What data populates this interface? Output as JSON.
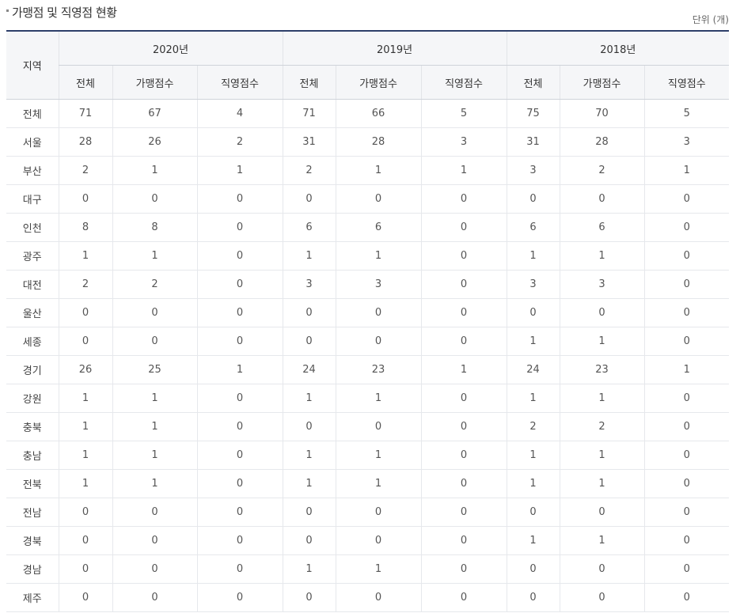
{
  "header": {
    "title": "가맹점 및 직영점 현황",
    "unit": "단위 (개)"
  },
  "table": {
    "region_header": "지역",
    "years": [
      "2020년",
      "2019년",
      "2018년"
    ],
    "sub_headers": [
      "전체",
      "가맹점수",
      "직영점수"
    ],
    "rows": [
      {
        "region": "전체",
        "values": [
          "71",
          "67",
          "4",
          "71",
          "66",
          "5",
          "75",
          "70",
          "5"
        ]
      },
      {
        "region": "서울",
        "values": [
          "28",
          "26",
          "2",
          "31",
          "28",
          "3",
          "31",
          "28",
          "3"
        ]
      },
      {
        "region": "부산",
        "values": [
          "2",
          "1",
          "1",
          "2",
          "1",
          "1",
          "3",
          "2",
          "1"
        ]
      },
      {
        "region": "대구",
        "values": [
          "0",
          "0",
          "0",
          "0",
          "0",
          "0",
          "0",
          "0",
          "0"
        ]
      },
      {
        "region": "인천",
        "values": [
          "8",
          "8",
          "0",
          "6",
          "6",
          "0",
          "6",
          "6",
          "0"
        ]
      },
      {
        "region": "광주",
        "values": [
          "1",
          "1",
          "0",
          "1",
          "1",
          "0",
          "1",
          "1",
          "0"
        ]
      },
      {
        "region": "대전",
        "values": [
          "2",
          "2",
          "0",
          "3",
          "3",
          "0",
          "3",
          "3",
          "0"
        ]
      },
      {
        "region": "울산",
        "values": [
          "0",
          "0",
          "0",
          "0",
          "0",
          "0",
          "0",
          "0",
          "0"
        ]
      },
      {
        "region": "세종",
        "values": [
          "0",
          "0",
          "0",
          "0",
          "0",
          "0",
          "1",
          "1",
          "0"
        ]
      },
      {
        "region": "경기",
        "values": [
          "26",
          "25",
          "1",
          "24",
          "23",
          "1",
          "24",
          "23",
          "1"
        ]
      },
      {
        "region": "강원",
        "values": [
          "1",
          "1",
          "0",
          "1",
          "1",
          "0",
          "1",
          "1",
          "0"
        ]
      },
      {
        "region": "충북",
        "values": [
          "1",
          "1",
          "0",
          "0",
          "0",
          "0",
          "2",
          "2",
          "0"
        ]
      },
      {
        "region": "충남",
        "values": [
          "1",
          "1",
          "0",
          "1",
          "1",
          "0",
          "1",
          "1",
          "0"
        ]
      },
      {
        "region": "전북",
        "values": [
          "1",
          "1",
          "0",
          "1",
          "1",
          "0",
          "1",
          "1",
          "0"
        ]
      },
      {
        "region": "전남",
        "values": [
          "0",
          "0",
          "0",
          "0",
          "0",
          "0",
          "0",
          "0",
          "0"
        ]
      },
      {
        "region": "경북",
        "values": [
          "0",
          "0",
          "0",
          "0",
          "0",
          "0",
          "1",
          "1",
          "0"
        ]
      },
      {
        "region": "경남",
        "values": [
          "0",
          "0",
          "0",
          "1",
          "1",
          "0",
          "0",
          "0",
          "0"
        ]
      },
      {
        "region": "제주",
        "values": [
          "0",
          "0",
          "0",
          "0",
          "0",
          "0",
          "0",
          "0",
          "0"
        ]
      }
    ]
  },
  "colors": {
    "header_border": "#2d3f6a",
    "header_bg": "#f5f6f8"
  }
}
